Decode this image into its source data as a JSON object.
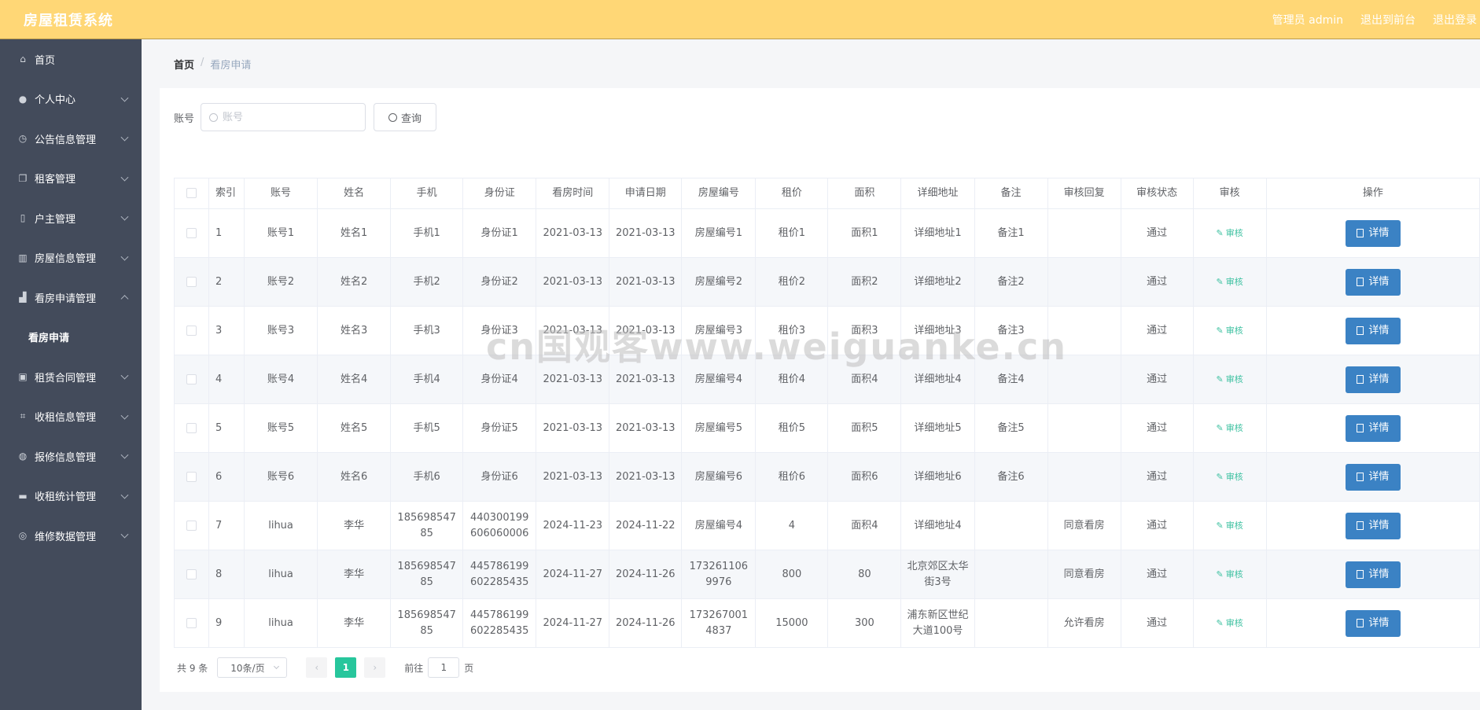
{
  "header": {
    "brand": "房屋租赁系统",
    "admin_label": "管理员 admin",
    "to_front": "退出到前台",
    "logout": "退出登录"
  },
  "sidebar": {
    "items": [
      {
        "label": "首页",
        "icon": "home-icon",
        "has_children": false
      },
      {
        "label": "个人中心",
        "icon": "user-icon",
        "has_children": true
      },
      {
        "label": "公告信息管理",
        "icon": "clock-icon",
        "has_children": true
      },
      {
        "label": "租客管理",
        "icon": "copy-icon",
        "has_children": true
      },
      {
        "label": "户主管理",
        "icon": "mic-icon",
        "has_children": true
      },
      {
        "label": "房屋信息管理",
        "icon": "chart-icon",
        "has_children": true
      },
      {
        "label": "看房申请管理",
        "icon": "thumb-icon",
        "has_children": true,
        "expanded": true
      },
      {
        "label": "租赁合同管理",
        "icon": "clipboard-icon",
        "has_children": true
      },
      {
        "label": "收租信息管理",
        "icon": "crop-icon",
        "has_children": true
      },
      {
        "label": "报修信息管理",
        "icon": "compass-icon",
        "has_children": true
      },
      {
        "label": "收租统计管理",
        "icon": "ticket-icon",
        "has_children": true
      },
      {
        "label": "维修数据管理",
        "icon": "target-icon",
        "has_children": true
      }
    ],
    "sub_active": "看房申请"
  },
  "breadcrumb": {
    "home": "首页",
    "separator": "/",
    "current": "看房申请"
  },
  "search": {
    "label": "账号",
    "placeholder": "账号",
    "button": "查询"
  },
  "table": {
    "headers": [
      "索引",
      "账号",
      "姓名",
      "手机",
      "身份证",
      "看房时间",
      "申请日期",
      "房屋编号",
      "租价",
      "面积",
      "详细地址",
      "备注",
      "审核回复",
      "审核状态",
      "审核",
      "操作"
    ],
    "audit_label": "审核",
    "detail_label": "详情",
    "rows": [
      [
        "1",
        "账号1",
        "姓名1",
        "手机1",
        "身份证1",
        "2021-03-13",
        "2021-03-13",
        "房屋编号1",
        "租价1",
        "面积1",
        "详细地址1",
        "备注1",
        "",
        "通过"
      ],
      [
        "2",
        "账号2",
        "姓名2",
        "手机2",
        "身份证2",
        "2021-03-13",
        "2021-03-13",
        "房屋编号2",
        "租价2",
        "面积2",
        "详细地址2",
        "备注2",
        "",
        "通过"
      ],
      [
        "3",
        "账号3",
        "姓名3",
        "手机3",
        "身份证3",
        "2021-03-13",
        "2021-03-13",
        "房屋编号3",
        "租价3",
        "面积3",
        "详细地址3",
        "备注3",
        "",
        "通过"
      ],
      [
        "4",
        "账号4",
        "姓名4",
        "手机4",
        "身份证4",
        "2021-03-13",
        "2021-03-13",
        "房屋编号4",
        "租价4",
        "面积4",
        "详细地址4",
        "备注4",
        "",
        "通过"
      ],
      [
        "5",
        "账号5",
        "姓名5",
        "手机5",
        "身份证5",
        "2021-03-13",
        "2021-03-13",
        "房屋编号5",
        "租价5",
        "面积5",
        "详细地址5",
        "备注5",
        "",
        "通过"
      ],
      [
        "6",
        "账号6",
        "姓名6",
        "手机6",
        "身份证6",
        "2021-03-13",
        "2021-03-13",
        "房屋编号6",
        "租价6",
        "面积6",
        "详细地址6",
        "备注6",
        "",
        "通过"
      ],
      [
        "7",
        "lihua",
        "李华",
        "18569854785",
        "440300199606060006",
        "2024-11-23",
        "2024-11-22",
        "房屋编号4",
        "4",
        "面积4",
        "详细地址4",
        "",
        "同意看房",
        "通过"
      ],
      [
        "8",
        "lihua",
        "李华",
        "18569854785",
        "445786199602285435",
        "2024-11-27",
        "2024-11-26",
        "1732611069976",
        "800",
        "80",
        "北京郊区太华街3号",
        "",
        "同意看房",
        "通过"
      ],
      [
        "9",
        "lihua",
        "李华",
        "18569854785",
        "445786199602285435",
        "2024-11-27",
        "2024-11-26",
        "1732670014837",
        "15000",
        "300",
        "浦东新区世纪大道100号",
        "",
        "允许看房",
        "通过"
      ]
    ]
  },
  "pagination": {
    "total": "共 9 条",
    "page_size": "10条/页",
    "current_page": "1",
    "goto_label": "前往",
    "goto_value": "1",
    "page_suffix": "页"
  },
  "watermark": "cn国观客www.weiguanke.cn",
  "colors": {
    "topbar": "#ffd776",
    "sidebar": "#434b5b",
    "primary_button": "#3b82c4",
    "accent_green": "#27c69c",
    "audit_link": "#3ec1a1"
  }
}
